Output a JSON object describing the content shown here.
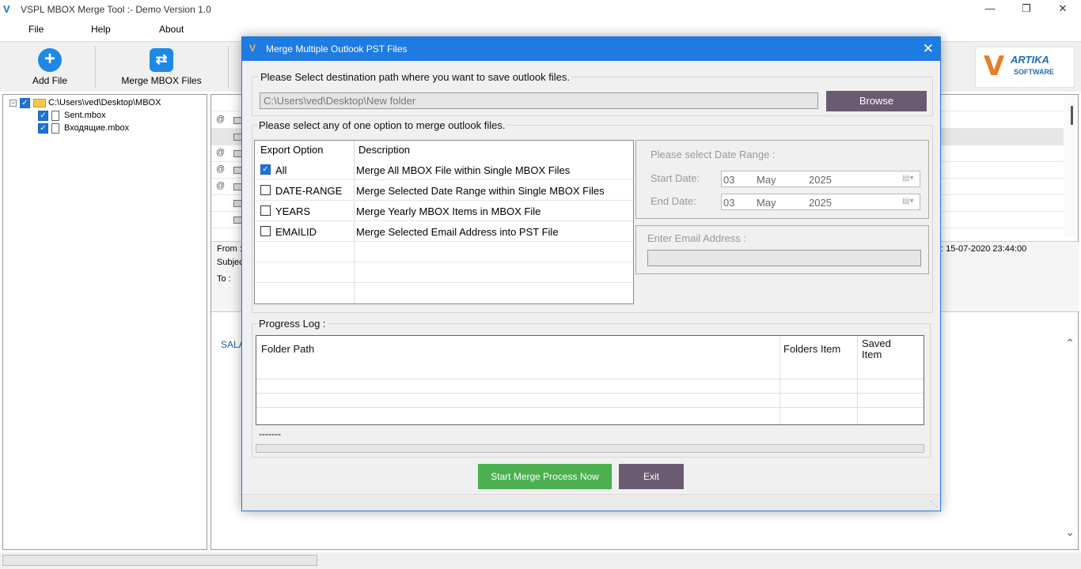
{
  "app": {
    "title": "VSPL MBOX Merge Tool  :- Demo Version 1.0",
    "icon_label": "V",
    "controls": {
      "minimize": "—",
      "restore": "❐",
      "close": "✕"
    }
  },
  "menu": {
    "file": "File",
    "help": "Help",
    "about": "About"
  },
  "toolbar": {
    "add_file": "Add File",
    "merge_mbox": "Merge MBOX Files",
    "add_glyph": "+",
    "merge_glyph": "⇄"
  },
  "logo": {
    "mark": "V",
    "line1": "ARTIKA",
    "line2": "SOFTWARE"
  },
  "tree": {
    "expander": "−",
    "check": "✓",
    "root": "C:\\Users\\ved\\Desktop\\MBOX",
    "children": [
      "Sent.mbox",
      "Входящие.mbox"
    ]
  },
  "preview": {
    "from_label": "From :",
    "subject_label": "Subjec",
    "to_label": "To :",
    "date_value": ": 15-07-2020 23:44:00",
    "body_snippet": "SALA",
    "attach_glyph": "@"
  },
  "dialog": {
    "title": "Merge Multiple Outlook PST Files",
    "close": "✕",
    "dest_label": "Please Select destination path where you want to save outlook files.",
    "dest_path": "C:\\Users\\ved\\Desktop\\New folder",
    "browse": "Browse",
    "option_label": "Please select any of one option to merge outlook files.",
    "table_headers": {
      "option": "Export Option",
      "description": "Description"
    },
    "options": [
      {
        "name": "All",
        "description": "Merge All MBOX File within Single MBOX Files",
        "checked": true
      },
      {
        "name": "DATE-RANGE",
        "description": "Merge Selected Date Range within Single MBOX Files",
        "checked": false
      },
      {
        "name": "YEARS",
        "description": "Merge Yearly MBOX Items in MBOX File",
        "checked": false
      },
      {
        "name": "EMAILID",
        "description": "Merge Selected Email Address into PST File",
        "checked": false
      }
    ],
    "date_range": {
      "label": "Please select Date Range :",
      "start_label": "Start Date:",
      "end_label": "End Date:",
      "start": {
        "day": "03",
        "month": "May",
        "year": "2025"
      },
      "end": {
        "day": "03",
        "month": "May",
        "year": "2025"
      }
    },
    "email_label": "Enter Email Address :",
    "email_value": "",
    "progress_log": {
      "label": "Progress Log :",
      "headers": {
        "folder_path": "Folder Path",
        "folders_item": "Folders Item",
        "saved_item_1": "Saved",
        "saved_item_2": "Item"
      },
      "status_text": "-------"
    },
    "start_button": "Start Merge Process Now",
    "exit_button": "Exit"
  }
}
